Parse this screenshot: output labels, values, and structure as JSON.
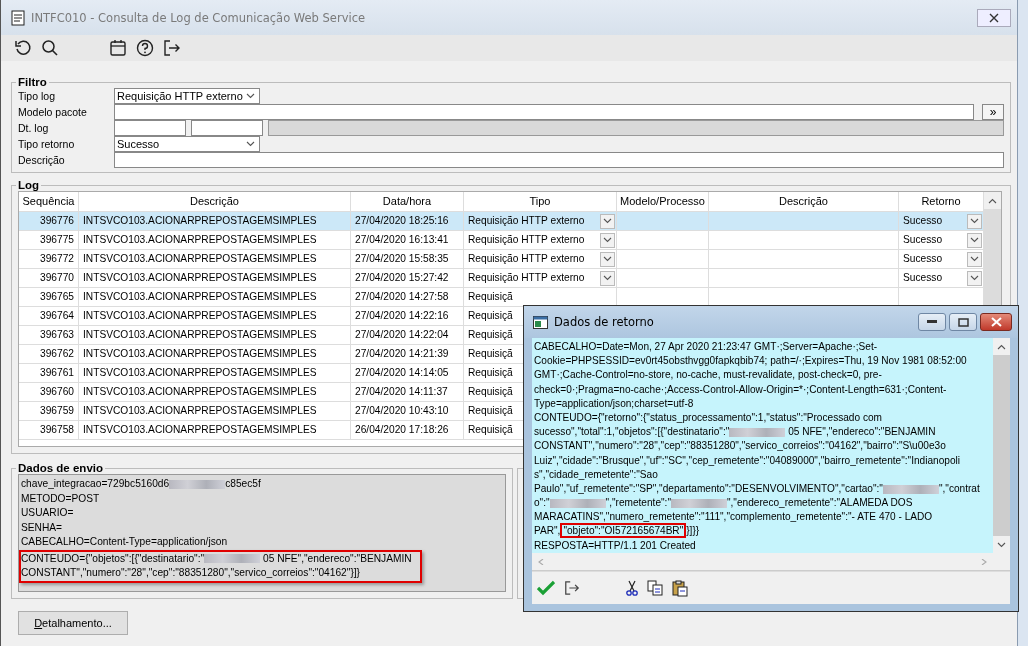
{
  "window": {
    "title": "INTFC010 - Consulta de Log de Comunicação Web Service"
  },
  "filter": {
    "title": "Filtro",
    "fields": [
      {
        "label": "Tipo log",
        "kind": "select",
        "value": "Requisição HTTP externo"
      },
      {
        "label": "Modelo pacote",
        "kind": "text_with_button",
        "button": "»"
      },
      {
        "label": "Dt. log",
        "kind": "date_range"
      },
      {
        "label": "Tipo retorno",
        "kind": "select",
        "value": "Sucesso"
      },
      {
        "label": "Descrição",
        "kind": "text"
      }
    ]
  },
  "log": {
    "title": "Log",
    "columns": [
      "Sequência",
      "Descrição",
      "Data/hora",
      "Tipo",
      "Modelo/Processo",
      "Descrição",
      "Retorno"
    ],
    "rows": [
      {
        "sequencia": "396776",
        "descricao": "INTSVCO103.ACIONARPREPOSTAGEMSIMPLES",
        "data_hora": "27/04/2020 18:25:16",
        "tipo": "Requisição HTTP externo",
        "retorno": "Sucesso",
        "selected": true
      },
      {
        "sequencia": "396775",
        "descricao": "INTSVCO103.ACIONARPREPOSTAGEMSIMPLES",
        "data_hora": "27/04/2020 16:13:41",
        "tipo": "Requisição HTTP externo",
        "retorno": "Sucesso",
        "selected": false
      },
      {
        "sequencia": "396772",
        "descricao": "INTSVCO103.ACIONARPREPOSTAGEMSIMPLES",
        "data_hora": "27/04/2020 15:58:35",
        "tipo": "Requisição HTTP externo",
        "retorno": "Sucesso",
        "selected": false
      },
      {
        "sequencia": "396770",
        "descricao": "INTSVCO103.ACIONARPREPOSTAGEMSIMPLES",
        "data_hora": "27/04/2020 15:27:42",
        "tipo": "Requisição HTTP externo",
        "retorno": "Sucesso",
        "selected": false
      },
      {
        "sequencia": "396765",
        "descricao": "INTSVCO103.ACIONARPREPOSTAGEMSIMPLES",
        "data_hora": "27/04/2020 14:27:58",
        "tipo": "Requisiçã",
        "selected": false
      },
      {
        "sequencia": "396764",
        "descricao": "INTSVCO103.ACIONARPREPOSTAGEMSIMPLES",
        "data_hora": "27/04/2020 14:22:16",
        "tipo": "Requisiçã",
        "selected": false
      },
      {
        "sequencia": "396763",
        "descricao": "INTSVCO103.ACIONARPREPOSTAGEMSIMPLES",
        "data_hora": "27/04/2020 14:22:04",
        "tipo": "Requisiçã",
        "selected": false
      },
      {
        "sequencia": "396762",
        "descricao": "INTSVCO103.ACIONARPREPOSTAGEMSIMPLES",
        "data_hora": "27/04/2020 14:21:39",
        "tipo": "Requisiçã",
        "selected": false
      },
      {
        "sequencia": "396761",
        "descricao": "INTSVCO103.ACIONARPREPOSTAGEMSIMPLES",
        "data_hora": "27/04/2020 14:14:05",
        "tipo": "Requisiçã",
        "selected": false
      },
      {
        "sequencia": "396760",
        "descricao": "INTSVCO103.ACIONARPREPOSTAGEMSIMPLES",
        "data_hora": "27/04/2020 14:11:37",
        "tipo": "Requisiçã",
        "selected": false
      },
      {
        "sequencia": "396759",
        "descricao": "INTSVCO103.ACIONARPREPOSTAGEMSIMPLES",
        "data_hora": "27/04/2020 10:43:10",
        "tipo": "Requisiçã",
        "selected": false
      },
      {
        "sequencia": "396758",
        "descricao": "INTSVCO103.ACIONARPREPOSTAGEMSIMPLES",
        "data_hora": "26/04/2020 17:18:26",
        "tipo": "Requisiçã",
        "selected": false
      }
    ]
  },
  "envio": {
    "title": "Dados de envio",
    "lines": [
      {
        "highlighted": false,
        "segments": [
          {
            "kind": "text",
            "text": "chave_integracao=729bc5160d6"
          },
          {
            "kind": "redacted"
          },
          {
            "kind": "text",
            "text": "c85ec5f"
          }
        ]
      },
      {
        "highlighted": false,
        "segments": [
          {
            "kind": "text",
            "text": "METODO=POST"
          }
        ]
      },
      {
        "highlighted": false,
        "segments": [
          {
            "kind": "text",
            "text": "USUARIO="
          }
        ]
      },
      {
        "highlighted": false,
        "segments": [
          {
            "kind": "text",
            "text": "SENHA="
          }
        ]
      },
      {
        "highlighted": false,
        "segments": [
          {
            "kind": "text",
            "text": "CABECALHO=Content-Type=application/json"
          }
        ]
      },
      {
        "highlighted": true,
        "segments": [
          {
            "kind": "text",
            "text": "CONTEUDO={\"objetos\":[{\"destinatario\":\""
          },
          {
            "kind": "redacted"
          },
          {
            "kind": "text",
            "text": " 05 NFE\",\"endereco\":\"BENJAMIN"
          }
        ]
      },
      {
        "highlighted": true,
        "segments": [
          {
            "kind": "text",
            "text": "CONSTANT\",\"numero\":\"28\",\"cep\":\"88351280\",\"servico_correios\":\"04162\"}]}"
          }
        ]
      }
    ]
  },
  "detail_button": "Detalhamento...",
  "dialog": {
    "title": "Dados de retorno",
    "lines": [
      [
        {
          "kind": "text",
          "text": "CABECALHO=Date=Mon, 27 Apr 2020 21:23:47 GMT·;Server=Apache·;Set-"
        }
      ],
      [
        {
          "kind": "text",
          "text": "Cookie=PHPSESSID=ev0rt45obsthvgg0fapkqbib74; path=/·;Expires=Thu, 19 Nov 1981 08:52:00"
        }
      ],
      [
        {
          "kind": "text",
          "text": "GMT·;Cache-Control=no-store, no-cache, must-revalidate, post-check=0, pre-"
        }
      ],
      [
        {
          "kind": "text",
          "text": "check=0·;Pragma=no-cache·;Access-Control-Allow-Origin=*·;Content-Length=631·;Content-"
        }
      ],
      [
        {
          "kind": "text",
          "text": "Type=application/json;charset=utf-8"
        }
      ],
      [
        {
          "kind": "text",
          "text": "CONTEUDO={\"retorno\":{\"status_processamento\":1,\"status\":\"Processado com"
        }
      ],
      [
        {
          "kind": "text",
          "text": "sucesso\",\"total\":1,\"objetos\":[{\"destinatario\":\""
        },
        {
          "kind": "redacted"
        },
        {
          "kind": "text",
          "text": " 05 NFE\",\"endereco\":\"BENJAMIN"
        }
      ],
      [
        {
          "kind": "text",
          "text": "CONSTANT\",\"numero\":\"28\",\"cep\":\"88351280\",\"servico_correios\":\"04162\",\"bairro\":\"S\\u00e3o"
        }
      ],
      [
        {
          "kind": "text",
          "text": "Luiz\",\"cidade\":\"Brusque\",\"uf\":\"SC\",\"cep_remetente\":\"04089000\",\"bairro_remetente\":\"Indianopoli"
        }
      ],
      [
        {
          "kind": "text",
          "text": "s\",\"cidade_remetente\":\"Sao"
        }
      ],
      [
        {
          "kind": "text",
          "text": "Paulo\",\"uf_remetente\":\"SP\",\"departamento\":\"DESENVOLVIMENTO\",\"cartao\":\""
        },
        {
          "kind": "redacted"
        },
        {
          "kind": "text",
          "text": "\",\"contrat"
        }
      ],
      [
        {
          "kind": "text",
          "text": "o\":\""
        },
        {
          "kind": "redacted"
        },
        {
          "kind": "text",
          "text": "\",\"remetente\":\""
        },
        {
          "kind": "redacted"
        },
        {
          "kind": "text",
          "text": "\",\"endereco_remetente\":\"ALAMEDA DOS"
        }
      ],
      [
        {
          "kind": "text",
          "text": "MARACATINS\",\"numero_remetente\":\"111\",\"complemento_remetente\":\"- ATE 470 - LADO"
        }
      ],
      [
        {
          "kind": "text",
          "text": "PAR\","
        },
        {
          "kind": "text",
          "text": "\"objeto\":\"OI572165674BR\"",
          "highlighted": true
        },
        {
          "kind": "text",
          "text": "}]}}"
        }
      ],
      [
        {
          "kind": "text",
          "text": "RESPOSTA=HTTP/1.1 201 Created"
        }
      ]
    ]
  }
}
